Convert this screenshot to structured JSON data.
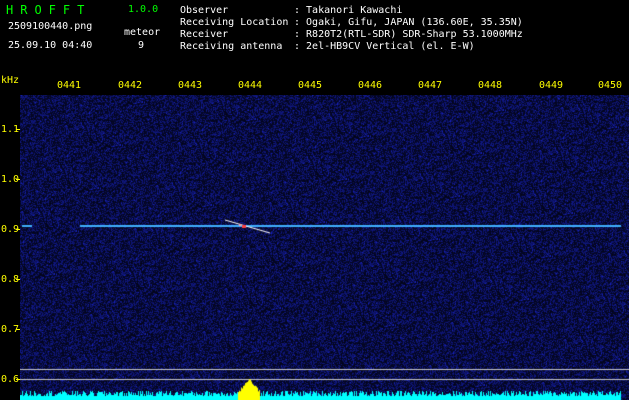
{
  "header": {
    "app_name": "HROFFT",
    "version": "1.0.0",
    "file_name": "2509100440.png",
    "datetime": "25.09.10 04:40",
    "meteor_label": "meteor",
    "meteor_count": "9"
  },
  "info": {
    "rows": [
      {
        "label": "Observer",
        "value": ": Takanori Kawachi"
      },
      {
        "label": "Receiving Location",
        "value": ": Ogaki, Gifu, JAPAN (136.60E, 35.35N)"
      },
      {
        "label": "Receiver",
        "value": ": R820T2(RTL-SDR) SDR-Sharp 53.1000MHz"
      },
      {
        "label": "Receiving antenna",
        "value": ": 2el-HB9CV Vertical (el. E-W)"
      }
    ]
  },
  "axes": {
    "y_unit": "kHz",
    "y_ticks": [
      "1.1",
      "1.0",
      "0.9",
      "0.8",
      "0.7",
      "0.6"
    ],
    "x_ticks": [
      "0441",
      "0442",
      "0443",
      "0444",
      "0445",
      "0446",
      "0447",
      "0448",
      "0449",
      "0450"
    ]
  },
  "colors": {
    "background": "#000000",
    "noise": "#1a2a7a",
    "carrier": "#40b0ff",
    "meteor": "#ff4040",
    "power_bar": "#00ffff",
    "power_peak": "#ffff00",
    "text": "#ffffff",
    "accent": "#ffff00",
    "app_title": "#00ff00"
  }
}
